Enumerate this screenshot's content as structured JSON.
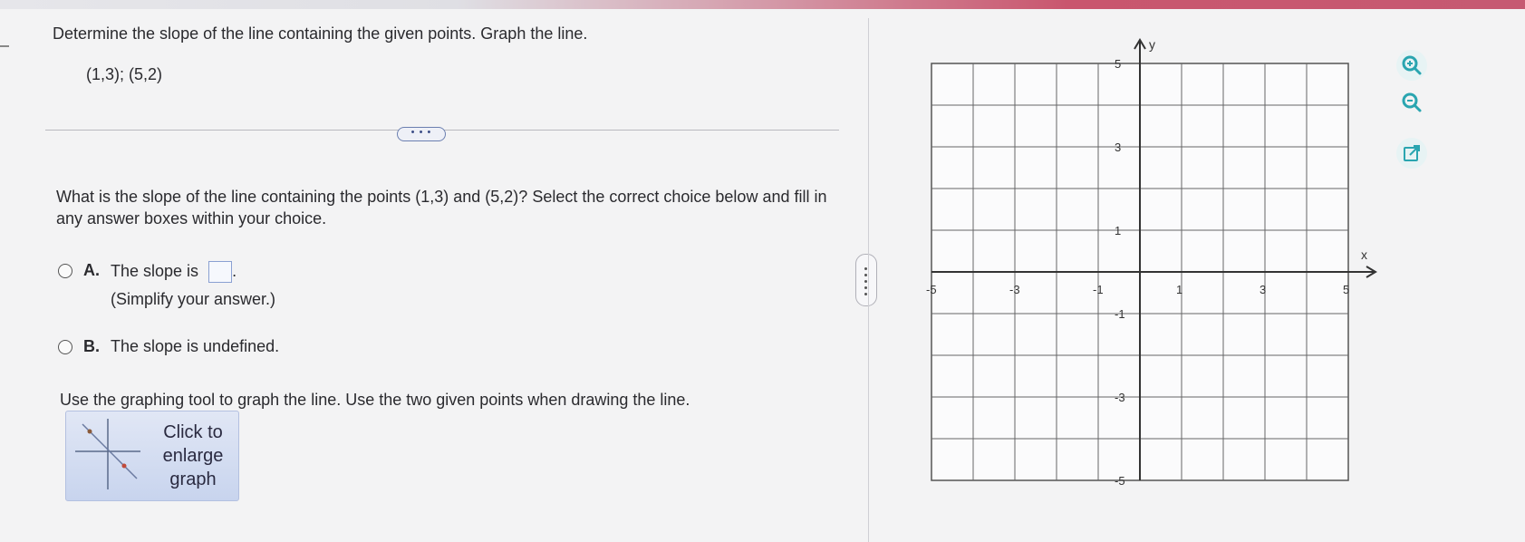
{
  "question": {
    "title": "Determine the slope of the line containing the given points. Graph the line.",
    "points": "(1,3); (5,2)",
    "more_label": "• • •",
    "prompt": "What is the slope of the line containing the points (1,3) and (5,2)? Select the correct choice below and fill in any answer boxes within your choice."
  },
  "choices": [
    {
      "letter": "A.",
      "text": "The slope is",
      "note": "(Simplify your answer.)"
    },
    {
      "letter": "B.",
      "text": "The slope is undefined."
    }
  ],
  "graph_instructions": "Use the graphing tool to graph the line. Use the two given points when drawing the line.",
  "enlarge_button": {
    "label": "Click to enlarge graph"
  },
  "graph": {
    "x_axis_label": "x",
    "y_axis_label": "y",
    "x_range": [
      -5,
      5
    ],
    "y_range": [
      -5,
      5
    ],
    "x_ticks": [
      "-5",
      "-3",
      "-1",
      "1",
      "3",
      "5"
    ],
    "y_ticks": [
      "5",
      "3",
      "1",
      "-1",
      "-3",
      "-5"
    ]
  },
  "tools": [
    "zoom-in-icon",
    "zoom-out-icon",
    "external-link-icon"
  ],
  "colors": {
    "accent": "#3b5bb5",
    "tool_teal": "#2aa5b0",
    "topbar": "#c65a72"
  }
}
